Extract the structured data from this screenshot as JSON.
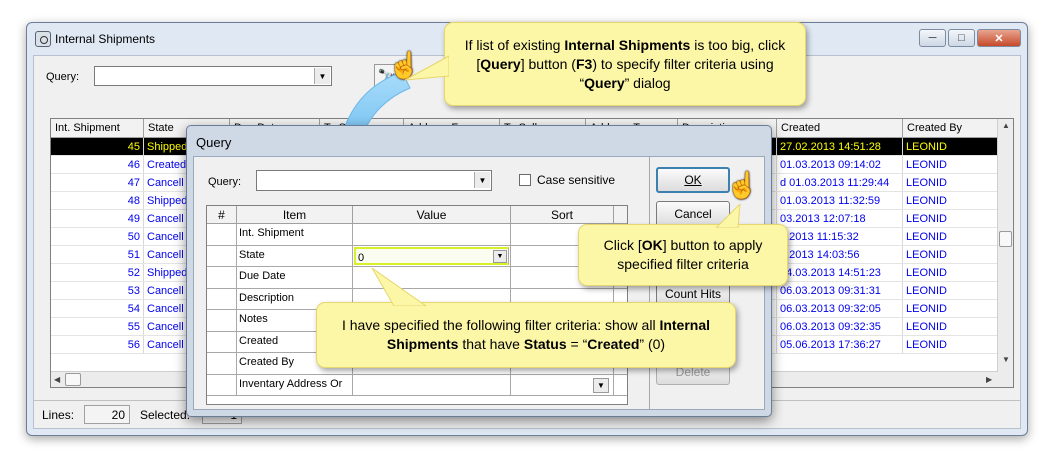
{
  "window": {
    "title": "Internal Shipments",
    "buttons": {
      "minimize": "─",
      "maximize": "□",
      "close": "✕"
    }
  },
  "toolbar": {
    "query_label": "Query:",
    "query_value": "",
    "find_button_glyph": "🔭"
  },
  "grid": {
    "headers": [
      "Int. Shipment",
      "State",
      "Due Date",
      "To Sell",
      "Address From",
      "To Sell",
      "Address To",
      "Description",
      "Created",
      "Created By"
    ],
    "rows": [
      {
        "id": "45",
        "state": "Shipped",
        "created": "27.02.2013 14:51:28",
        "created_by": "LEONID",
        "selected": true
      },
      {
        "id": "46",
        "state": "Created",
        "created": "01.03.2013 09:14:02",
        "created_by": "LEONID"
      },
      {
        "id": "47",
        "state": "Cancell",
        "created": "d 01.03.2013 11:29:44",
        "created_by": "LEONID"
      },
      {
        "id": "48",
        "state": "Shipped",
        "created": "01.03.2013 11:32:59",
        "created_by": "LEONID"
      },
      {
        "id": "49",
        "state": "Cancell",
        "created": "03.2013 12:07:18",
        "created_by": "LEONID"
      },
      {
        "id": "50",
        "state": "Cancell",
        "created": "3.2013 11:15:32",
        "created_by": "LEONID"
      },
      {
        "id": "51",
        "state": "Cancell",
        "created": "3.2013 14:03:56",
        "created_by": "LEONID"
      },
      {
        "id": "52",
        "state": "Shipped",
        "created": "04.03.2013 14:51:23",
        "created_by": "LEONID"
      },
      {
        "id": "53",
        "state": "Cancell",
        "created": "06.03.2013 09:31:31",
        "created_by": "LEONID"
      },
      {
        "id": "54",
        "state": "Cancell",
        "created": "06.03.2013 09:32:05",
        "created_by": "LEONID"
      },
      {
        "id": "55",
        "state": "Cancell",
        "created": "06.03.2013 09:32:35",
        "created_by": "LEONID"
      },
      {
        "id": "56",
        "state": "Cancell",
        "created": "05.06.2013 17:36:27",
        "created_by": "LEONID"
      }
    ]
  },
  "status": {
    "lines_label": "Lines:",
    "lines_value": "20",
    "selected_label": "Selected:",
    "selected_value": "1"
  },
  "dialog": {
    "title": "Query",
    "query_label": "Query:",
    "query_value": "",
    "case_sensitive_label": "Case sensitive",
    "columns": [
      "#",
      "Item",
      "Value",
      "Sort"
    ],
    "rows": [
      {
        "item": "Int. Shipment",
        "value": ""
      },
      {
        "item": "State",
        "value": "0"
      },
      {
        "item": "Due Date",
        "value": ""
      },
      {
        "item": "Description",
        "value": ""
      },
      {
        "item": "Notes",
        "value": ""
      },
      {
        "item": "Created",
        "value": ""
      },
      {
        "item": "Created By",
        "value": ""
      },
      {
        "item": "Inventary Address Or",
        "value": ""
      }
    ],
    "buttons": {
      "ok": "OK",
      "cancel": "Cancel",
      "count_hits": "Count Hits",
      "more": "...",
      "delete": "Delete"
    }
  },
  "callouts": {
    "top": {
      "p1": "If list of existing ",
      "b1": "Internal Shipments",
      "p2": " is too big, click [",
      "b2": "Query",
      "p3": "] button (",
      "b3": "F3",
      "p4": ") to specify filter criteria using “",
      "b4": "Query",
      "p5": "” dialog"
    },
    "ok": {
      "p1": "Click [",
      "b1": "OK",
      "p2": "] button to apply specified filter criteria"
    },
    "filter": {
      "p1": "I have specified the following filter criteria: show all ",
      "b1": "Internal Shipments",
      "p2": " that have ",
      "b2": "Status",
      "p3": " = “",
      "b3": "Created",
      "p4": "” (0)"
    }
  },
  "colors": {
    "callout_bg": "#fcf6a7",
    "row_text": "#0000ee",
    "selected_row_bg": "#000000",
    "selected_row_text": "#ffff00",
    "arrow_blue": "#2f9fe0",
    "highlight_border": "#d9ef2a"
  }
}
